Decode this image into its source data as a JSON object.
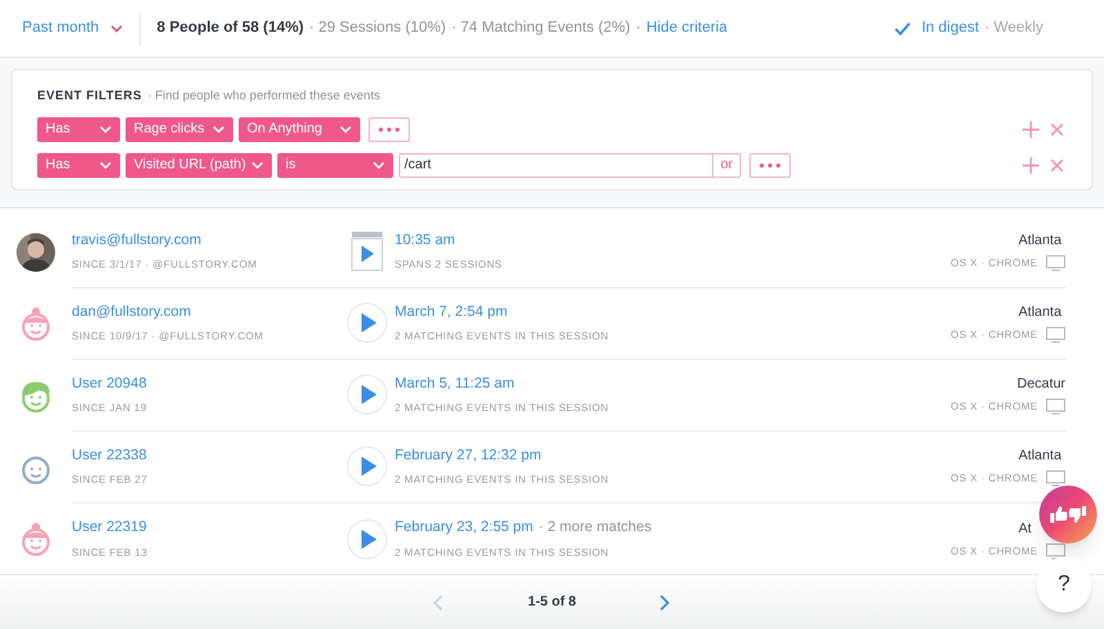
{
  "header": {
    "range": "Past month",
    "summary": [
      {
        "text": "8 People of 58 (14%)",
        "kind": "strong"
      },
      {
        "text": "· 29 Sessions (10%)",
        "kind": "muted"
      },
      {
        "text": "· 74 Matching Events (2%)",
        "kind": "muted"
      },
      {
        "text": "·",
        "kind": "muted"
      },
      {
        "text": "Hide criteria",
        "kind": "link"
      }
    ],
    "digest": {
      "checked": true,
      "label": "In digest",
      "frequency": "· Weekly"
    }
  },
  "filters": {
    "title": "EVENT FILTERS",
    "hint": "· Find people who performed these events",
    "rows": [
      {
        "selects": [
          "Has",
          "Rage clicks",
          "On Anything"
        ]
      },
      {
        "selects": [
          "Has",
          "Visited URL (path)",
          "is"
        ],
        "value": "/cart",
        "or": "or"
      }
    ]
  },
  "people": [
    {
      "name": "travis@fullstory.com",
      "since": "SINCE 3/1/17 · @FULLSTORY.COM",
      "session": {
        "kind": "multi",
        "time": "10:35 am",
        "sub": "SPANS 2 SESSIONS"
      },
      "city": "Atlanta",
      "device": "OS X · CHROME"
    },
    {
      "avatar": {
        "kind": "bun",
        "color": "#f7a1b4"
      },
      "name": "dan@fullstory.com",
      "since": "SINCE 10/9/17 · @FULLSTORY.COM",
      "session": {
        "kind": "single",
        "time": "March 7, 2:54 pm",
        "sub": "2 MATCHING EVENTS IN THIS SESSION"
      },
      "city": "Atlanta",
      "device": "OS X · CHROME"
    },
    {
      "avatar": {
        "kind": "hair",
        "color": "#8ccd6f"
      },
      "name": "User 20948",
      "since": "SINCE JAN 19",
      "session": {
        "kind": "single",
        "time": "March 5, 11:25 am",
        "sub": "2 MATCHING EVENTS IN THIS SESSION"
      },
      "city": "Decatur",
      "device": "OS X · CHROME"
    },
    {
      "avatar": {
        "kind": "plain",
        "color": "#90aecb"
      },
      "name": "User 22338",
      "since": "SINCE FEB 27",
      "session": {
        "kind": "single",
        "time": "February 27, 12:32 pm",
        "sub": "2 MATCHING EVENTS IN THIS SESSION"
      },
      "city": "Atlanta",
      "device": "OS X · CHROME"
    },
    {
      "avatar": {
        "kind": "bun",
        "color": "#f7a1b4"
      },
      "name": "User 22319",
      "since": "SINCE FEB 13",
      "session": {
        "kind": "single",
        "time": "February 23, 2:55 pm",
        "extra": "· 2 more matches",
        "sub": "2 MATCHING EVENTS IN THIS SESSION"
      },
      "city": "At",
      "device": "OS X · CHROME"
    }
  ],
  "pager": {
    "prev": {
      "disabled": true
    },
    "label": "1-5 of 8",
    "next": {
      "disabled": false
    }
  },
  "help": "?"
}
